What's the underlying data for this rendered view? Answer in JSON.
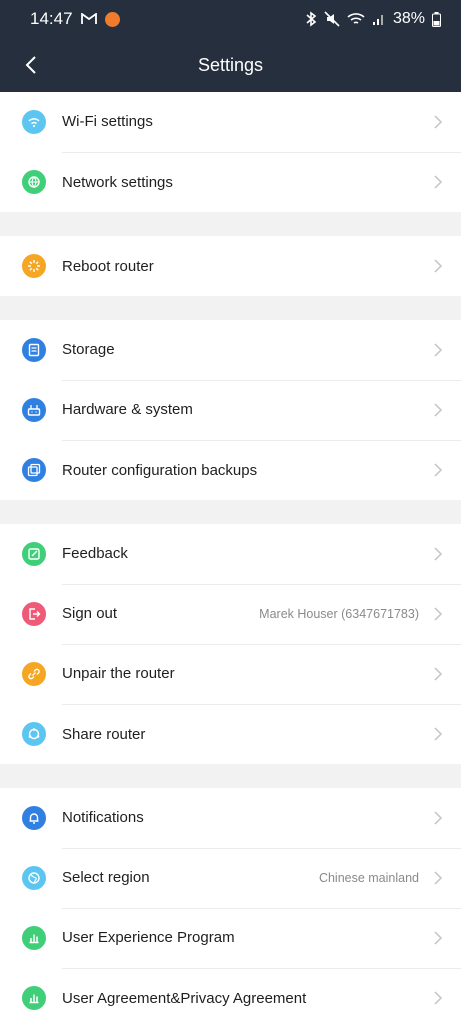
{
  "status": {
    "time": "14:47",
    "battery": "38%"
  },
  "header": {
    "title": "Settings"
  },
  "groups": [
    [
      {
        "id": "wifi",
        "label": "Wi-Fi settings",
        "icon": "wifi-icon",
        "color": "#5cc6f0"
      },
      {
        "id": "network",
        "label": "Network settings",
        "icon": "globe-icon",
        "color": "#3fcf78"
      }
    ],
    [
      {
        "id": "reboot",
        "label": "Reboot router",
        "icon": "reboot-icon",
        "color": "#f5a623"
      }
    ],
    [
      {
        "id": "storage",
        "label": "Storage",
        "icon": "storage-icon",
        "color": "#2f80e0"
      },
      {
        "id": "hardware",
        "label": "Hardware & system",
        "icon": "router-icon",
        "color": "#2f80e0"
      },
      {
        "id": "backups",
        "label": "Router configuration backups",
        "icon": "backup-icon",
        "color": "#2f80e0"
      }
    ],
    [
      {
        "id": "feedback",
        "label": "Feedback",
        "icon": "feedback-icon",
        "color": "#3fcf78"
      },
      {
        "id": "signout",
        "label": "Sign out",
        "value": "Marek Houser (6347671783)",
        "icon": "sign-out-icon",
        "color": "#ef5a78"
      },
      {
        "id": "unpair",
        "label": "Unpair the router",
        "icon": "link-icon",
        "color": "#f5a623"
      },
      {
        "id": "share",
        "label": "Share router",
        "icon": "share-icon",
        "color": "#5cc6f0"
      }
    ],
    [
      {
        "id": "notifications",
        "label": "Notifications",
        "icon": "bell-icon",
        "color": "#2f80e0"
      },
      {
        "id": "region",
        "label": "Select region",
        "value": "Chinese mainland",
        "icon": "region-icon",
        "color": "#5cc6f0"
      },
      {
        "id": "uep",
        "label": "User Experience Program",
        "icon": "chart-icon",
        "color": "#3fcf78"
      },
      {
        "id": "agreement",
        "label": "User Agreement&Privacy Agreement",
        "icon": "chart-icon",
        "color": "#3fcf78"
      }
    ]
  ]
}
